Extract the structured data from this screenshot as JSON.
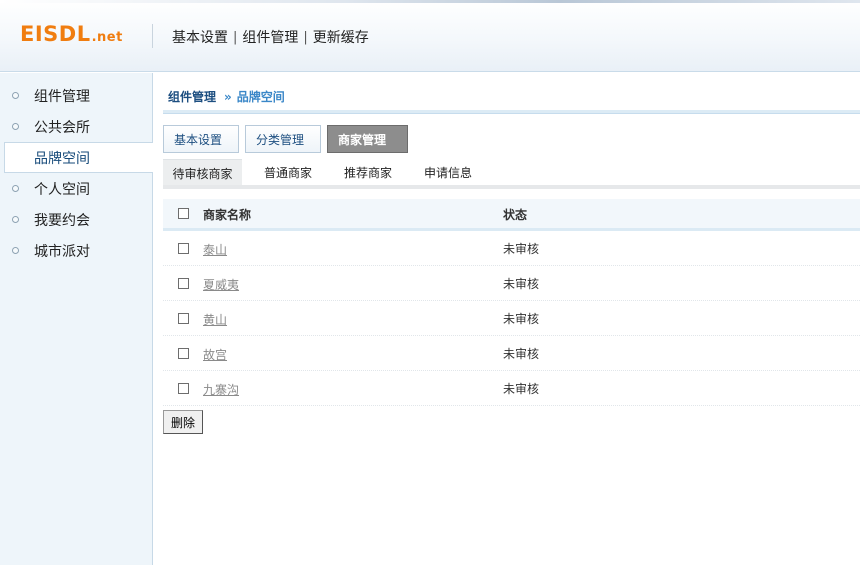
{
  "header": {
    "logo_main": "EISDL",
    "logo_suffix": ".net",
    "nav": [
      "基本设置",
      "组件管理",
      "更新缓存"
    ],
    "nav_divider": "|"
  },
  "sidebar": {
    "items": [
      {
        "label": "组件管理",
        "active": false
      },
      {
        "label": "公共会所",
        "active": false
      },
      {
        "label": "品牌空间",
        "active": true
      },
      {
        "label": "个人空间",
        "active": false
      },
      {
        "label": "我要约会",
        "active": false
      },
      {
        "label": "城市派对",
        "active": false
      }
    ]
  },
  "breadcrumb": {
    "root": "组件管理",
    "separator": "»",
    "current": "品牌空间"
  },
  "tabs": [
    {
      "label": "基本设置",
      "active": false
    },
    {
      "label": "分类管理",
      "active": false
    },
    {
      "label": "商家管理",
      "active": true
    }
  ],
  "subtabs": [
    {
      "label": "待审核商家",
      "active": true
    },
    {
      "label": "普通商家",
      "active": false
    },
    {
      "label": "推荐商家",
      "active": false
    },
    {
      "label": "申请信息",
      "active": false
    }
  ],
  "table": {
    "columns": [
      "商家名称",
      "状态"
    ],
    "rows": [
      {
        "name": "泰山",
        "status": "未审核"
      },
      {
        "name": "夏威夷",
        "status": "未审核"
      },
      {
        "name": "黄山",
        "status": "未审核"
      },
      {
        "name": "故宫",
        "status": "未审核"
      },
      {
        "name": "九寨沟",
        "status": "未审核"
      }
    ]
  },
  "actions": {
    "delete_label": "删除"
  },
  "colors": {
    "brand": "#f07d10",
    "link": "#1c4e80",
    "accent": "#3a87c8",
    "active_tab": "#8d8d8d"
  }
}
